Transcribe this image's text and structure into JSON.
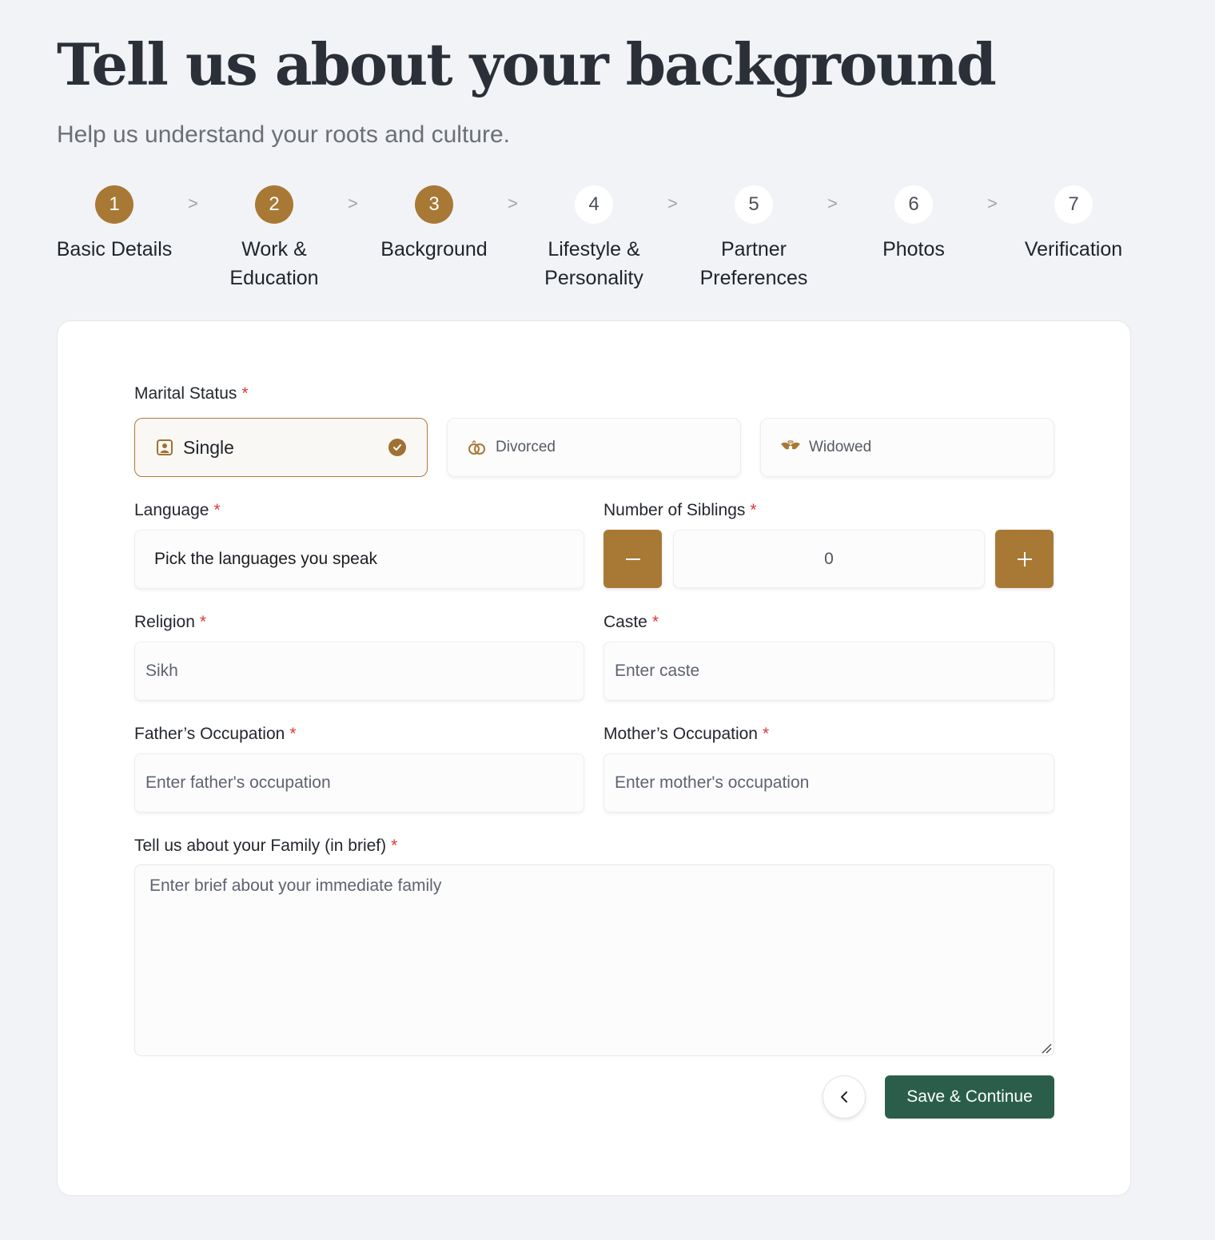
{
  "header": {
    "title": "Tell us about your background",
    "subtitle": "Help us understand your roots and culture."
  },
  "steps": [
    {
      "number": "1",
      "line1": "Basic Details",
      "line2": "",
      "state": "completed"
    },
    {
      "number": "2",
      "line1": "Work &",
      "line2": "Education",
      "state": "completed"
    },
    {
      "number": "3",
      "line1": "Background",
      "line2": "",
      "state": "current"
    },
    {
      "number": "4",
      "line1": "Lifestyle &",
      "line2": "Personality",
      "state": "upcoming"
    },
    {
      "number": "5",
      "line1": "Partner",
      "line2": "Preferences",
      "state": "upcoming"
    },
    {
      "number": "6",
      "line1": "Photos",
      "line2": "",
      "state": "upcoming"
    },
    {
      "number": "7",
      "line1": "Verification",
      "line2": "",
      "state": "upcoming"
    }
  ],
  "step_separator": ">",
  "form": {
    "required_mark": "*",
    "marital_status": {
      "label": "Marital Status",
      "options": [
        {
          "label": "Single",
          "icon": "person-portrait-icon",
          "selected": true
        },
        {
          "label": "Divorced",
          "icon": "rings-icon",
          "selected": false
        },
        {
          "label": "Widowed",
          "icon": "angel-wings-icon",
          "selected": false
        }
      ]
    },
    "language": {
      "label": "Language",
      "value": "Pick the languages you speak"
    },
    "siblings": {
      "label": "Number of Siblings",
      "value": "0",
      "decrement": "−",
      "increment": "+"
    },
    "religion": {
      "label": "Religion",
      "placeholder": "Sikh"
    },
    "caste": {
      "label": "Caste",
      "placeholder": "Enter caste"
    },
    "father_occupation": {
      "label": "Father’s Occupation",
      "placeholder": "Enter father's occupation"
    },
    "mother_occupation": {
      "label": "Mother’s Occupation",
      "placeholder": "Enter mother's occupation"
    },
    "family": {
      "label": "Tell us about your Family (in brief)",
      "placeholder": "Enter brief about your immediate family"
    }
  },
  "actions": {
    "back_icon": "chevron-left-icon",
    "save_label": "Save & Continue"
  },
  "colors": {
    "accent": "#a87835",
    "primary_button": "#2a5e4b",
    "required": "#d93a3a",
    "background": "#f2f3f7"
  }
}
